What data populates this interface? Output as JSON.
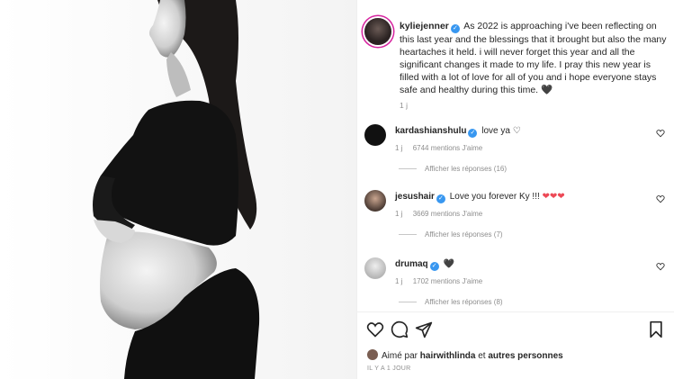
{
  "post": {
    "username": "kyliejenner",
    "caption": "As 2022 is approaching i've been reflecting on this last year and the blessings that it brought but also the many heartaches it held. i will never forget this year and all the significant changes it made to my life. I pray this new year is filled with a lot of love for all of you and i hope everyone stays safe and healthy during this time.",
    "caption_emoji": "🖤",
    "time": "1 j"
  },
  "comments": [
    {
      "username": "kardashianshulu",
      "text": "love ya",
      "emoji": "♡",
      "time": "1 j",
      "likes": "6744 mentions J'aime",
      "replies": "Afficher les réponses (16)"
    },
    {
      "username": "jesushair",
      "text": "Love you forever Ky !!!",
      "emoji": "❤❤❤",
      "time": "1 j",
      "likes": "3669 mentions J'aime",
      "replies": "Afficher les réponses (7)"
    },
    {
      "username": "drumaq",
      "text": "",
      "emoji": "🖤",
      "time": "1 j",
      "likes": "1702 mentions J'aime",
      "replies": "Afficher les réponses (8)"
    }
  ],
  "liked_by": {
    "prefix": "Aimé par",
    "user": "hairwithlinda",
    "joiner": "et",
    "others": "autres personnes"
  },
  "posted_ago": "IL Y A 1 JOUR",
  "colors": {
    "verified": "#3897f0",
    "heart_red": "#ed4956",
    "muted": "#8e8e8e",
    "text": "#262626"
  },
  "icons": {
    "like": "heart-outline-icon",
    "comment": "comment-bubble-icon",
    "share": "paper-plane-icon",
    "save": "bookmark-icon",
    "verified": "verified-badge-icon",
    "comment_like": "heart-small-icon"
  }
}
